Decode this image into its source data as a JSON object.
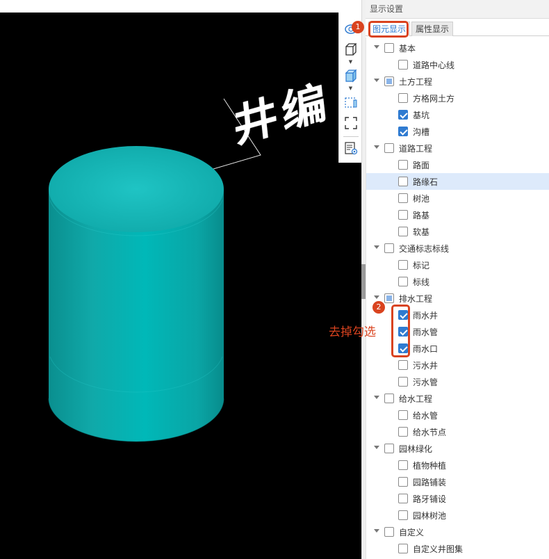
{
  "viewport": {
    "scene_label": "井编"
  },
  "panel": {
    "title": "显示设置",
    "tabs": [
      {
        "label": "图元显示"
      },
      {
        "label": "属性显示"
      }
    ]
  },
  "tree": [
    {
      "label": "基本",
      "level": 0,
      "state": "unchecked"
    },
    {
      "label": "道路中心线",
      "level": 1,
      "state": "unchecked"
    },
    {
      "label": "土方工程",
      "level": 0,
      "state": "partial"
    },
    {
      "label": "方格网土方",
      "level": 1,
      "state": "unchecked"
    },
    {
      "label": "基坑",
      "level": 1,
      "state": "checked"
    },
    {
      "label": "沟槽",
      "level": 1,
      "state": "checked"
    },
    {
      "label": "道路工程",
      "level": 0,
      "state": "unchecked"
    },
    {
      "label": "路面",
      "level": 1,
      "state": "unchecked"
    },
    {
      "label": "路缘石",
      "level": 1,
      "state": "unchecked",
      "highlight": true
    },
    {
      "label": "树池",
      "level": 1,
      "state": "unchecked"
    },
    {
      "label": "路基",
      "level": 1,
      "state": "unchecked"
    },
    {
      "label": "软基",
      "level": 1,
      "state": "unchecked"
    },
    {
      "label": "交通标志标线",
      "level": 0,
      "state": "unchecked"
    },
    {
      "label": "标记",
      "level": 1,
      "state": "unchecked"
    },
    {
      "label": "标线",
      "level": 1,
      "state": "unchecked"
    },
    {
      "label": "排水工程",
      "level": 0,
      "state": "partial"
    },
    {
      "label": "雨水井",
      "level": 1,
      "state": "checked"
    },
    {
      "label": "雨水管",
      "level": 1,
      "state": "checked"
    },
    {
      "label": "雨水口",
      "level": 1,
      "state": "checked"
    },
    {
      "label": "污水井",
      "level": 1,
      "state": "unchecked"
    },
    {
      "label": "污水管",
      "level": 1,
      "state": "unchecked"
    },
    {
      "label": "给水工程",
      "level": 0,
      "state": "unchecked"
    },
    {
      "label": "给水管",
      "level": 1,
      "state": "unchecked"
    },
    {
      "label": "给水节点",
      "level": 1,
      "state": "unchecked"
    },
    {
      "label": "园林绿化",
      "level": 0,
      "state": "unchecked"
    },
    {
      "label": "植物种植",
      "level": 1,
      "state": "unchecked"
    },
    {
      "label": "园路铺装",
      "level": 1,
      "state": "unchecked"
    },
    {
      "label": "路牙铺设",
      "level": 1,
      "state": "unchecked"
    },
    {
      "label": "园林树池",
      "level": 1,
      "state": "unchecked"
    },
    {
      "label": "自定义",
      "level": 0,
      "state": "unchecked"
    },
    {
      "label": "自定义井图集",
      "level": 1,
      "state": "unchecked"
    }
  ],
  "annotations": {
    "badge1": "1",
    "badge2": "2",
    "instruction": "去掉勾选",
    "color": "#d9431f"
  },
  "colors": {
    "accent": "#2f7bd1",
    "cylinder": "#00b3b3",
    "viewport_bg": "#000000"
  }
}
